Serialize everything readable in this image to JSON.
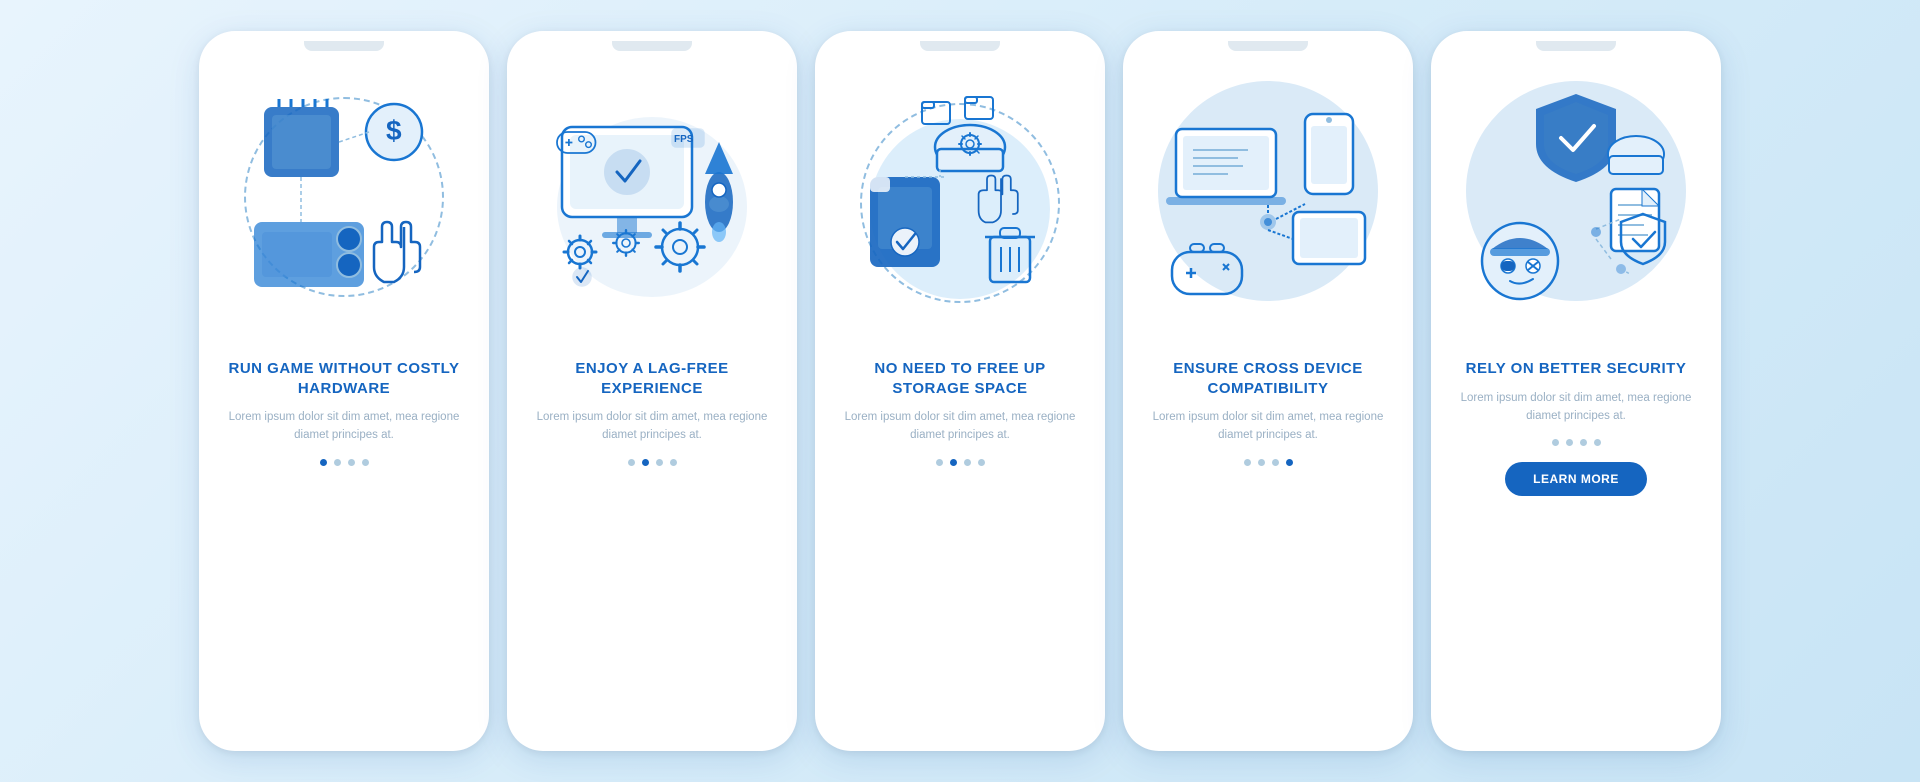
{
  "cards": [
    {
      "id": "card-1",
      "title": "RUN GAME WITHOUT COSTLY HARDWARE",
      "description": "Lorem ipsum dolor sit dim amet, mea regione diamet principes at.",
      "dots": [
        true,
        false,
        false,
        false
      ],
      "illustration": "hardware",
      "hasBgCircle": false,
      "hasDashedCircle": true,
      "hasLearnMore": false
    },
    {
      "id": "card-2",
      "title": "ENJOY A LAG-FREE EXPERIENCE",
      "description": "Lorem ipsum dolor sit dim amet, mea regione diamet principes at.",
      "dots": [
        false,
        true,
        false,
        false
      ],
      "illustration": "lagfree",
      "hasBgCircle": false,
      "hasDashedCircle": false,
      "hasLearnMore": false
    },
    {
      "id": "card-3",
      "title": "NO NEED TO FREE UP STORAGE SPACE",
      "description": "Lorem ipsum dolor sit dim amet, mea regione diamet principes at.",
      "dots": [
        false,
        true,
        false,
        false
      ],
      "illustration": "storage",
      "hasBgCircle": true,
      "hasDashedCircle": true,
      "hasLearnMore": false
    },
    {
      "id": "card-4",
      "title": "ENSURE CROSS DEVICE COMPATIBILITY",
      "description": "Lorem ipsum dolor sit dim amet, mea regione diamet principes at.",
      "dots": [
        false,
        false,
        false,
        true
      ],
      "illustration": "crossdevice",
      "hasBgCircle": true,
      "hasDashedCircle": false,
      "hasLearnMore": false
    },
    {
      "id": "card-5",
      "title": "RELY ON BETTER SECURITY",
      "description": "Lorem ipsum dolor sit dim amet, mea regione diamet principes at.",
      "dots": [
        false,
        false,
        false,
        false
      ],
      "illustration": "security",
      "hasBgCircle": true,
      "hasDashedCircle": false,
      "hasLearnMore": true,
      "learnMoreLabel": "LEARN MORE"
    }
  ],
  "colors": {
    "accent": "#1565c0",
    "lightBlue": "#dceefb",
    "iconColor": "#1976d2",
    "textLight": "#9ab0c4"
  }
}
